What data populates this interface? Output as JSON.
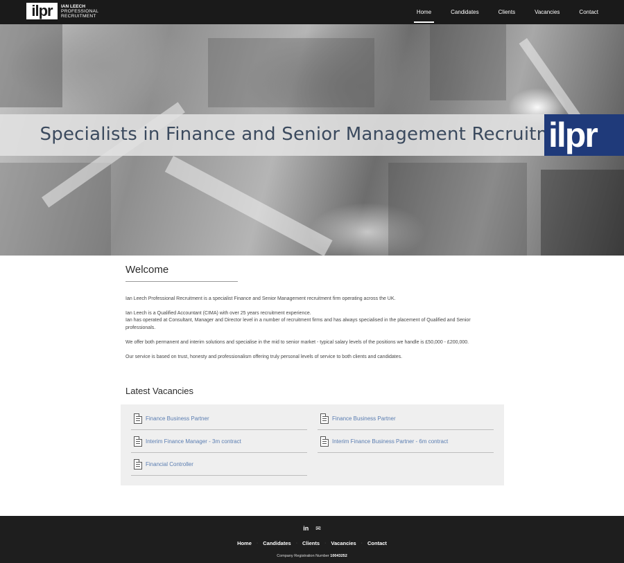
{
  "header": {
    "logo_mark": "ilpr",
    "logo_line1": "IAN LEECH",
    "logo_line2": "PROFESSIONAL",
    "logo_line3": "RECRUITMENT",
    "nav": [
      "Home",
      "Candidates",
      "Clients",
      "Vacancies",
      "Contact"
    ],
    "active_nav": "Home"
  },
  "hero": {
    "title": "Specialists in Finance and Senior Management Recruitment",
    "badge": "ilpr"
  },
  "welcome": {
    "title": "Welcome",
    "paragraphs": [
      "Ian Leech Professional Recruitment is a specialist Finance and Senior Management recruitment firm operating across the UK.",
      "Ian Leech is a Qualified Accountant (CIMA) with over 25 years recruitment experience.",
      "Ian has operated at Consultant, Manager and Director level in a number of recruitment firms and has always specialised in the placement of Qualified and Senior professionals.",
      "We offer both permanent and interim solutions and specialise in the mid to senior market - typical salary levels of the positions we handle is £50,000 - £200,000.",
      "Our service is based on trust, honesty and professionalism offering truly personal levels of service to both clients and candidates."
    ]
  },
  "vacancies": {
    "title": "Latest Vacancies",
    "items": [
      "Finance Business Partner",
      "Finance Business Partner",
      "Interim Finance Manager - 3m contract",
      "Interim Finance Business Partner - 6m contract",
      "Financial Controller"
    ]
  },
  "footer": {
    "social": [
      "in",
      "✉"
    ],
    "nav": [
      "Home",
      "Candidates",
      "Clients",
      "Vacancies",
      "Contact"
    ],
    "reg_label": "Company Registration Number",
    "reg_number": "10043252"
  },
  "colors": {
    "header_bg": "#1a1a1a",
    "badge_blue": "#1f3a7a",
    "link_blue": "#5a7db1",
    "footer_bg": "#1e1e1e"
  }
}
